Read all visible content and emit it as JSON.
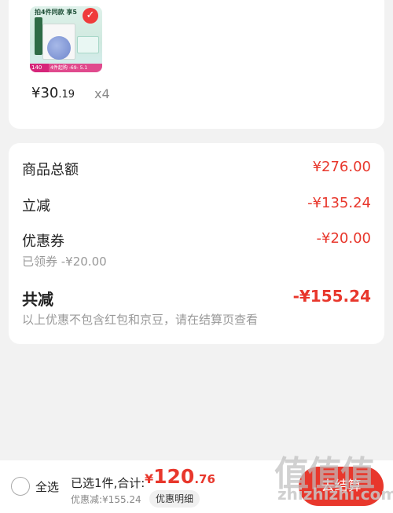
{
  "product": {
    "image_label": "product-image",
    "image_header": "拍4件同款 享5",
    "image_badge": "140",
    "image_bar_text": "4件起购 -69- 5.1",
    "price_int": "¥30",
    "price_dec": ".19",
    "quantity": "x4"
  },
  "summary": {
    "goods_total_label": "商品总额",
    "goods_total_value": "¥276.00",
    "instant_discount_label": "立减",
    "instant_discount_value": "-¥135.24",
    "coupon_label": "优惠券",
    "coupon_value": "-¥20.00",
    "coupon_sub": "已领券 -¥20.00",
    "total_reduce_label": "共减",
    "total_reduce_value": "-¥155.24",
    "note": "以上优惠不包含红包和京豆，请在结算页查看"
  },
  "bottom": {
    "select_all": "全选",
    "selected_text": "已选1件,合计:",
    "total_symbol": "¥",
    "total_int": "120",
    "total_dec": ".76",
    "discount_text": "优惠减:¥155.24",
    "detail_button": "优惠明细",
    "checkout_button": "去结算"
  },
  "watermark": {
    "logo": "值值值",
    "url": "zhizhizhi.com"
  },
  "colors": {
    "accent": "#e8372c",
    "background": "#f2f2f2"
  }
}
